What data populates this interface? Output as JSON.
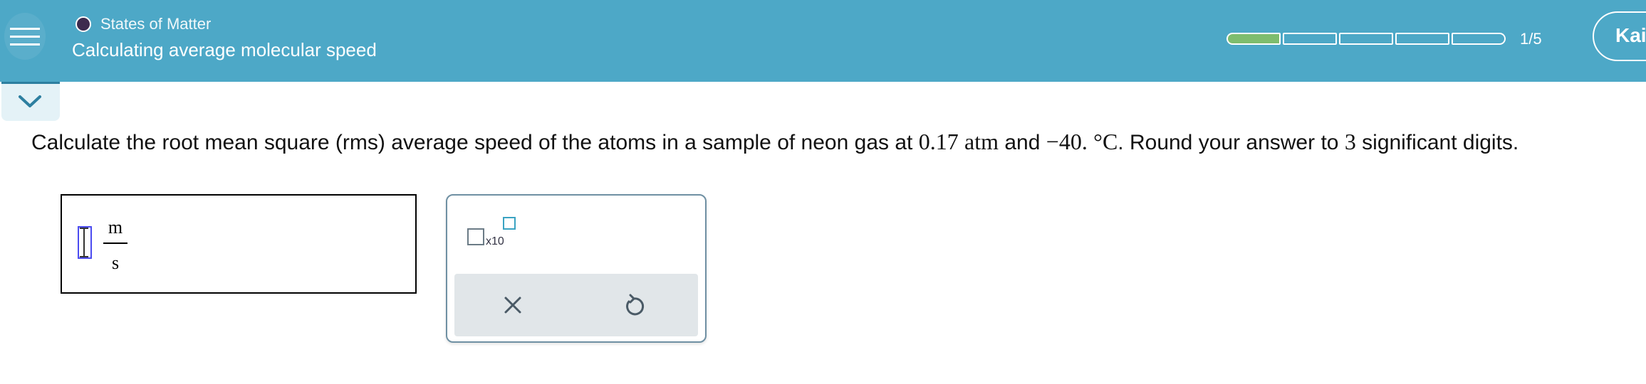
{
  "header": {
    "topic": "States of Matter",
    "title": "Calculating average molecular speed",
    "progress": {
      "completed": 1,
      "total": 5,
      "label": "1/5"
    },
    "user_button_label": "Kai"
  },
  "question": {
    "p1": "Calculate the root mean square (rms) average speed of the atoms in a sample of neon gas at ",
    "pressure": "0.17",
    "pressure_unit": "atm",
    "and": " and ",
    "temperature": "−40.",
    "temperature_unit": "°C",
    "p2": ". Round your answer to ",
    "digits": "3",
    "p3": " significant digits."
  },
  "answer": {
    "value": "",
    "unit_numerator": "m",
    "unit_denominator": "s"
  },
  "palette": {
    "sci_notation_label": "x10"
  },
  "colors": {
    "header_bg": "#4da8c7",
    "progress_done": "#7ebd6e",
    "topic_dot": "#3d2b4e"
  },
  "icons": [
    "hamburger-menu-icon",
    "chevron-down-icon",
    "close-icon",
    "undo-icon"
  ]
}
